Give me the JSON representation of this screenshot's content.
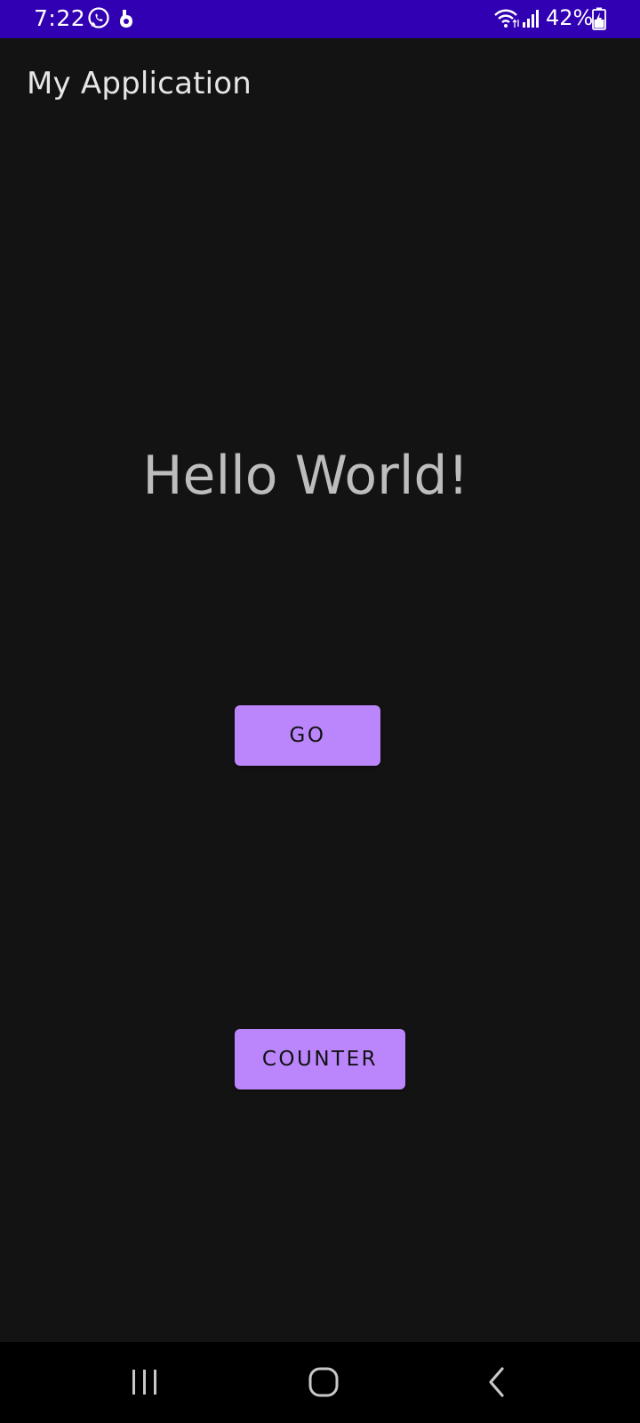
{
  "status_bar": {
    "time": "7:22",
    "battery": "42%",
    "background_color": "#3200b3",
    "icons": [
      "whatsapp-icon",
      "notification-app-icon",
      "wifi-icon",
      "signal-icon",
      "battery-icon"
    ]
  },
  "app": {
    "title": "My Application"
  },
  "main": {
    "greeting": "Hello World!",
    "go_button_label": "GO",
    "counter_button_label": "COUNTER",
    "button_color": "#bb86fc"
  },
  "nav_bar": {
    "icons": [
      "recent-apps-icon",
      "home-icon",
      "back-icon"
    ]
  }
}
